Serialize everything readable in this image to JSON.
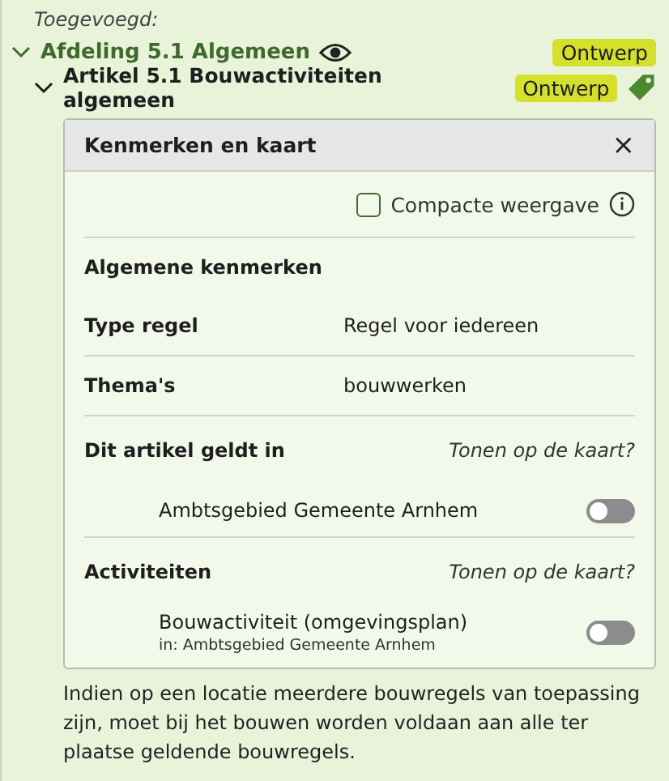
{
  "added_label": "Toegevoegd:",
  "section": {
    "title": "Afdeling 5.1 Algemeen",
    "expanded": true,
    "badge": "Ontwerp"
  },
  "article": {
    "title": "Artikel 5.1 Bouwactiviteiten algemeen",
    "expanded": true,
    "badge": "Ontwerp"
  },
  "panel": {
    "title": "Kenmerken en kaart",
    "close": "×",
    "compact": {
      "label": "Compacte weergave",
      "checked": false
    },
    "general": {
      "heading": "Algemene kenmerken",
      "rows": [
        {
          "label": "Type regel",
          "value": "Regel voor iedereen"
        },
        {
          "label": "Thema's",
          "value": "bouwwerken"
        }
      ]
    },
    "groups": [
      {
        "heading": "Dit artikel geldt in",
        "hint": "Tonen op de kaart?",
        "items": [
          {
            "label": "Ambtsgebied Gemeente Arnhem",
            "on": false
          }
        ]
      },
      {
        "heading": "Activiteiten",
        "hint": "Tonen op de kaart?",
        "items": [
          {
            "label": "Bouwactiviteit (omgevingsplan)",
            "sub": "in: Ambtsgebied Gemeente Arnhem",
            "on": false
          }
        ]
      }
    ]
  },
  "paragraph": "Indien op een locatie meerdere bouwregels van toepassing zijn, moet bij het bouwen worden voldaan aan alle ter plaatse geldende bouwregels."
}
